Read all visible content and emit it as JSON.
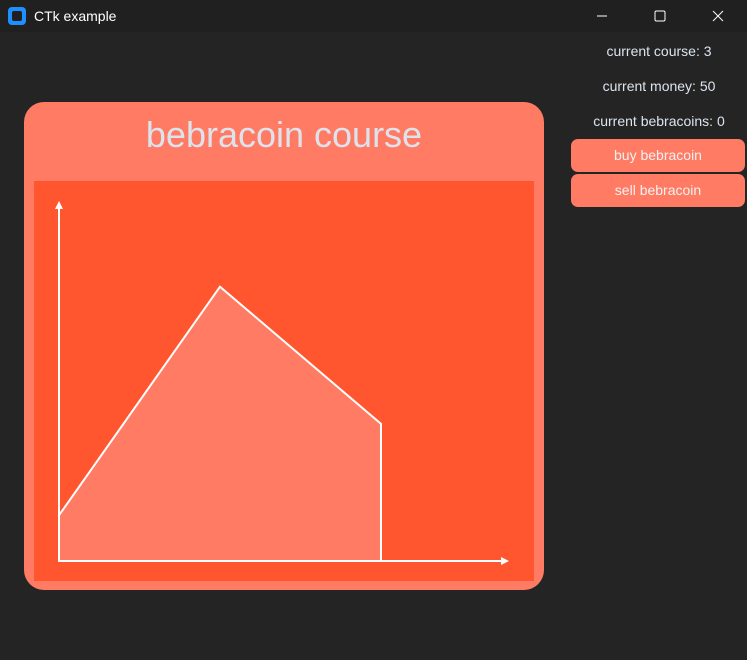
{
  "window": {
    "title": "CTk example"
  },
  "chart_card": {
    "title": "bebracoin course"
  },
  "sidebar": {
    "course_label": "current course: 3",
    "money_label": "current money: 50",
    "bebracoins_label": "current bebracoins: 0",
    "buy_button": "buy bebracoin",
    "sell_button": "sell bebracoin"
  },
  "colors": {
    "background": "#242424",
    "card": "#ff7b63",
    "plot_background": "#ff5630",
    "axis": "#ffffff"
  },
  "chart_data": {
    "type": "area",
    "title": "bebracoin course",
    "xlabel": "",
    "ylabel": "",
    "x": [
      0,
      1,
      2
    ],
    "values": [
      1,
      6,
      3
    ],
    "ylim": [
      0,
      7
    ],
    "grid": false
  }
}
